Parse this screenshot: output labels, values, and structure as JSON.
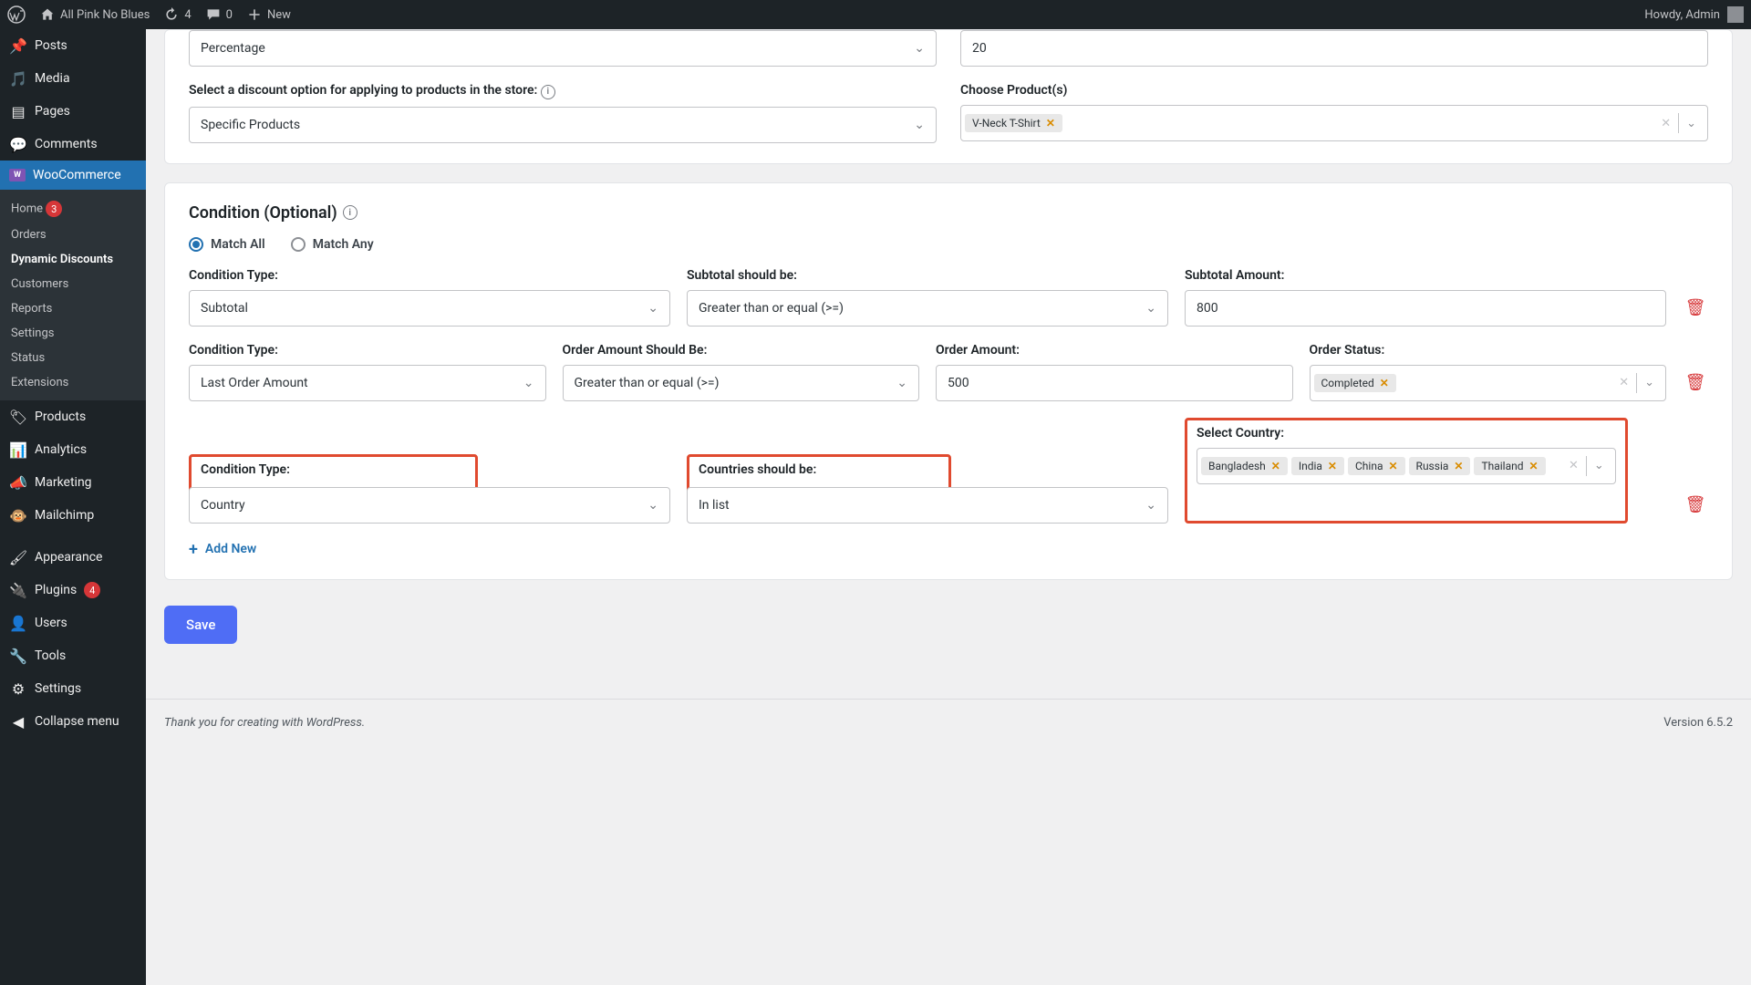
{
  "adminbar": {
    "site_name": "All Pink No Blues",
    "updates": "4",
    "comments": "0",
    "new_label": "New",
    "howdy": "Howdy, Admin"
  },
  "sidebar": {
    "items": [
      {
        "label": "Posts",
        "icon": "pin"
      },
      {
        "label": "Media",
        "icon": "media"
      },
      {
        "label": "Pages",
        "icon": "page"
      },
      {
        "label": "Comments",
        "icon": "comment"
      },
      {
        "label": "WooCommerce",
        "icon": "woo",
        "active": true
      },
      {
        "label": "Products",
        "icon": "tag"
      },
      {
        "label": "Analytics",
        "icon": "chart"
      },
      {
        "label": "Marketing",
        "icon": "megaphone"
      },
      {
        "label": "Mailchimp",
        "icon": "mailchimp"
      },
      {
        "label": "Appearance",
        "icon": "brush"
      },
      {
        "label": "Plugins",
        "icon": "plug",
        "badge": "4"
      },
      {
        "label": "Users",
        "icon": "user"
      },
      {
        "label": "Tools",
        "icon": "wrench"
      },
      {
        "label": "Settings",
        "icon": "sliders"
      },
      {
        "label": "Collapse menu",
        "icon": "collapse"
      }
    ],
    "submenu": [
      {
        "label": "Home",
        "badge": "3"
      },
      {
        "label": "Orders"
      },
      {
        "label": "Dynamic Discounts",
        "current": true
      },
      {
        "label": "Customers"
      },
      {
        "label": "Reports"
      },
      {
        "label": "Settings"
      },
      {
        "label": "Status"
      },
      {
        "label": "Extensions"
      }
    ]
  },
  "discount": {
    "type_value": "Percentage",
    "amount_value": "20",
    "option_label": "Select a discount option for applying to products in the store:",
    "option_value": "Specific Products",
    "products_label": "Choose Product(s)",
    "products": [
      "V-Neck T-Shirt"
    ]
  },
  "condition": {
    "title": "Condition (Optional)",
    "match_all": "Match All",
    "match_any": "Match Any",
    "rows": {
      "r1": {
        "type_label": "Condition Type:",
        "type_value": "Subtotal",
        "op_label": "Subtotal should be:",
        "op_value": "Greater than or equal (>=)",
        "amt_label": "Subtotal Amount:",
        "amt_value": "800"
      },
      "r2": {
        "type_label": "Condition Type:",
        "type_value": "Last Order Amount",
        "op_label": "Order Amount Should Be:",
        "op_value": "Greater than or equal (>=)",
        "amt_label": "Order Amount:",
        "amt_value": "500",
        "status_label": "Order Status:",
        "status_values": [
          "Completed"
        ]
      },
      "r3": {
        "type_label": "Condition Type:",
        "type_value": "Country",
        "op_label": "Countries should be:",
        "op_value": "In list",
        "countries_label": "Select Country:",
        "countries": [
          "Bangladesh",
          "India",
          "China",
          "Russia",
          "Thailand"
        ]
      }
    },
    "add_new": "Add New",
    "save": "Save"
  },
  "footer": {
    "thanks": "Thank you for creating with WordPress.",
    "version": "Version 6.5.2"
  }
}
